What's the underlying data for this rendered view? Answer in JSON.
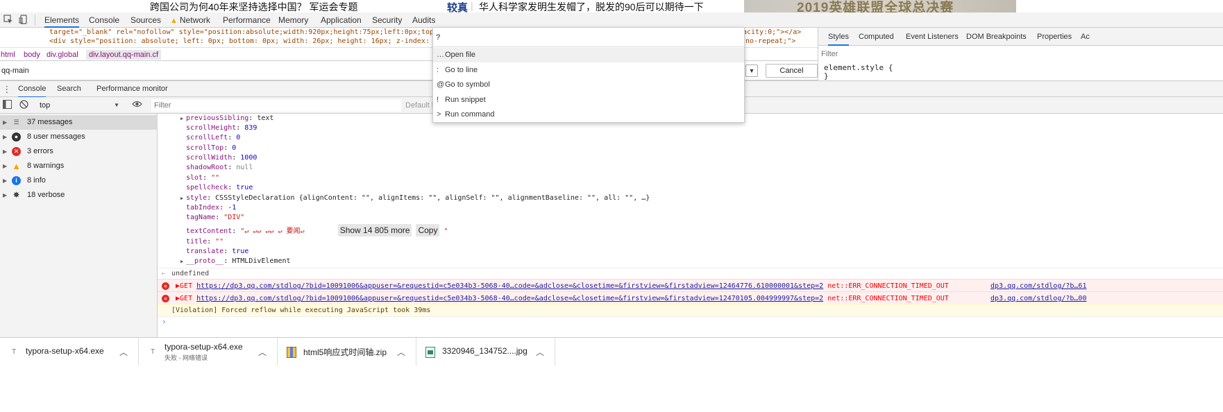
{
  "page_strip": {
    "headline_1": "跨国公司为何40年来坚持选择中国？ 军运会专题",
    "tag": "较真",
    "headline_2": "华人科学家发明生发帽了，脱发的90后可以期待一下",
    "banner_text": "2019英雄联盟全球总决赛"
  },
  "toolbar": {
    "tabs": [
      "Elements",
      "Console",
      "Sources",
      "Network",
      "Performance",
      "Memory",
      "Application",
      "Security",
      "Audits"
    ]
  },
  "dom_snippet": {
    "line_1": "target=\"_blank\" rel=\"nofollow\" style=\"position:absolute;width:920px;height:75px;left:0px;top:0",
    "line_1_tail": "acity:0;\"></a>",
    "line_2": "<div style=\"position: absolute; left: 0px; bottom: 0px; width: 26px; height: 16px; z-index: 12",
    "line_2_tail": "no-repeat;\">"
  },
  "breadcrumbs": [
    "html",
    "body",
    "div.global",
    "div.layout.qq-main.cf"
  ],
  "search": {
    "value": "qq-main",
    "cancel_label": "Cancel"
  },
  "styles_pane": {
    "tabs": [
      "Styles",
      "Computed",
      "Event Listeners",
      "DOM Breakpoints",
      "Properties",
      "Ac"
    ],
    "filter_placeholder": "Filter",
    "element_style_open": "element.style {",
    "element_style_close": "}"
  },
  "drawer": {
    "tabs": [
      "Console",
      "Search",
      "Performance monitor"
    ]
  },
  "console_toolbar": {
    "context": "top",
    "filter_placeholder": "Filter",
    "levels": "Default l"
  },
  "sidebar": {
    "items": [
      {
        "label": "37 messages",
        "icon": "list-icon"
      },
      {
        "label": "8 user messages",
        "icon": "user-icon"
      },
      {
        "label": "3 errors",
        "icon": "error-icon"
      },
      {
        "label": "8 warnings",
        "icon": "warning-icon"
      },
      {
        "label": "8 info",
        "icon": "info-icon"
      },
      {
        "label": "18 verbose",
        "icon": "bug-icon"
      }
    ]
  },
  "console_props": {
    "previousSibling_k": "previousSibling",
    "previousSibling_v": "text",
    "scrollHeight_k": "scrollHeight",
    "scrollHeight_v": "839",
    "scrollLeft_k": "scrollLeft",
    "scrollLeft_v": "0",
    "scrollTop_k": "scrollTop",
    "scrollTop_v": "0",
    "scrollWidth_k": "scrollWidth",
    "scrollWidth_v": "1000",
    "shadowRoot_k": "shadowRoot",
    "shadowRoot_v": "null",
    "slot_k": "slot",
    "slot_v": "\"\"",
    "spellcheck_k": "spellcheck",
    "spellcheck_v": "true",
    "style_k": "style",
    "style_v": "CSSStyleDeclaration {alignContent: \"\", alignItems: \"\", alignSelf: \"\", alignmentBaseline: \"\", all: \"\", …}",
    "tabIndex_k": "tabIndex",
    "tabIndex_v": "-1",
    "tagName_k": "tagName",
    "tagName_v": "\"DIV\"",
    "textContent_k": "textContent",
    "textContent_v": "\"↵      ↵↵        ↵↵          ↵            要闻↵",
    "show_more": "Show 14 805 more",
    "copy": "Copy",
    "textContent_end": "\"",
    "title_k": "title",
    "title_v": "\"\"",
    "translate_k": "translate",
    "translate_v": "true",
    "proto_k": "__proto__",
    "proto_v": "HTMLDivElement"
  },
  "result": "undefined",
  "errors": [
    {
      "method": "GET",
      "url": "https://dp3.qq.com/stdlog/?bid=10091006&appuser=&requestid=c5e034b3-5068-40…code=&adclose=&closetime=&firstview=&firstadview=12464776.610000001&step=2",
      "status": "net::ERR_CONNECTION_TIMED_OUT",
      "source": "dp3.qq.com/stdlog/?b…61"
    },
    {
      "method": "GET",
      "url": "https://dp3.qq.com/stdlog/?bid=10091006&appuser=&requestid=c5e034b3-5068-40…code=&adclose=&closetime=&firstview=&firstadview=12470105.004999997&step=2",
      "status": "net::ERR_CONNECTION_TIMED_OUT",
      "source": "dp3.qq.com/stdlog/?b…00"
    }
  ],
  "violation": "[Violation] Forced reflow while executing JavaScript took 39ms",
  "command_menu": {
    "input": "?",
    "items": [
      {
        "prefix": "…",
        "label": "Open file"
      },
      {
        "prefix": ":",
        "label": "Go to line"
      },
      {
        "prefix": "@",
        "label": "Go to symbol"
      },
      {
        "prefix": "!",
        "label": "Run snippet"
      },
      {
        "prefix": ">",
        "label": "Run command"
      }
    ]
  },
  "downloads": [
    {
      "name": "typora-setup-x64.exe",
      "status": ""
    },
    {
      "name": "typora-setup-x64.exe",
      "status": "失败 - 网络错误"
    },
    {
      "name": "html5响应式时间轴.zip",
      "status": ""
    },
    {
      "name": "3320946_134752....jpg",
      "status": ""
    }
  ]
}
